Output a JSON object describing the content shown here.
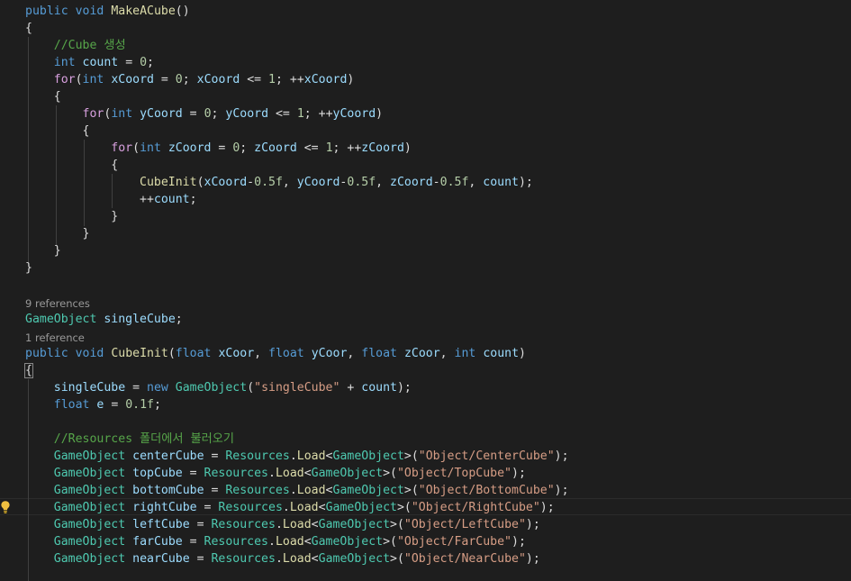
{
  "editor": {
    "lines": [
      [
        [
          "kw",
          "public"
        ],
        [
          "pl",
          " "
        ],
        [
          "kw",
          "void"
        ],
        [
          "pl",
          " "
        ],
        [
          "method",
          "MakeACube"
        ],
        [
          "pl",
          "()"
        ]
      ],
      [
        [
          "pl",
          "{"
        ]
      ],
      [
        [
          "pl",
          "    "
        ],
        [
          "cmt",
          "//Cube 생성"
        ]
      ],
      [
        [
          "pl",
          "    "
        ],
        [
          "kw",
          "int"
        ],
        [
          "pl",
          " "
        ],
        [
          "var",
          "count"
        ],
        [
          "pl",
          " = "
        ],
        [
          "num",
          "0"
        ],
        [
          "pl",
          ";"
        ]
      ],
      [
        [
          "pl",
          "    "
        ],
        [
          "ctrl",
          "for"
        ],
        [
          "pl",
          "("
        ],
        [
          "kw",
          "int"
        ],
        [
          "pl",
          " "
        ],
        [
          "var",
          "xCoord"
        ],
        [
          "pl",
          " = "
        ],
        [
          "num",
          "0"
        ],
        [
          "pl",
          "; "
        ],
        [
          "var",
          "xCoord"
        ],
        [
          "pl",
          " <= "
        ],
        [
          "num",
          "1"
        ],
        [
          "pl",
          "; ++"
        ],
        [
          "var",
          "xCoord"
        ],
        [
          "pl",
          ")"
        ]
      ],
      [
        [
          "pl",
          "    {"
        ]
      ],
      [
        [
          "pl",
          "        "
        ],
        [
          "ctrl",
          "for"
        ],
        [
          "pl",
          "("
        ],
        [
          "kw",
          "int"
        ],
        [
          "pl",
          " "
        ],
        [
          "var",
          "yCoord"
        ],
        [
          "pl",
          " = "
        ],
        [
          "num",
          "0"
        ],
        [
          "pl",
          "; "
        ],
        [
          "var",
          "yCoord"
        ],
        [
          "pl",
          " <= "
        ],
        [
          "num",
          "1"
        ],
        [
          "pl",
          "; ++"
        ],
        [
          "var",
          "yCoord"
        ],
        [
          "pl",
          ")"
        ]
      ],
      [
        [
          "pl",
          "        {"
        ]
      ],
      [
        [
          "pl",
          "            "
        ],
        [
          "ctrl",
          "for"
        ],
        [
          "pl",
          "("
        ],
        [
          "kw",
          "int"
        ],
        [
          "pl",
          " "
        ],
        [
          "var",
          "zCoord"
        ],
        [
          "pl",
          " = "
        ],
        [
          "num",
          "0"
        ],
        [
          "pl",
          "; "
        ],
        [
          "var",
          "zCoord"
        ],
        [
          "pl",
          " <= "
        ],
        [
          "num",
          "1"
        ],
        [
          "pl",
          "; ++"
        ],
        [
          "var",
          "zCoord"
        ],
        [
          "pl",
          ")"
        ]
      ],
      [
        [
          "pl",
          "            {"
        ]
      ],
      [
        [
          "pl",
          "                "
        ],
        [
          "method",
          "CubeInit"
        ],
        [
          "pl",
          "("
        ],
        [
          "var",
          "xCoord"
        ],
        [
          "pl",
          "-"
        ],
        [
          "num",
          "0.5f"
        ],
        [
          "pl",
          ", "
        ],
        [
          "var",
          "yCoord"
        ],
        [
          "pl",
          "-"
        ],
        [
          "num",
          "0.5f"
        ],
        [
          "pl",
          ", "
        ],
        [
          "var",
          "zCoord"
        ],
        [
          "pl",
          "-"
        ],
        [
          "num",
          "0.5f"
        ],
        [
          "pl",
          ", "
        ],
        [
          "var",
          "count"
        ],
        [
          "pl",
          ");"
        ]
      ],
      [
        [
          "pl",
          "                ++"
        ],
        [
          "var",
          "count"
        ],
        [
          "pl",
          ";"
        ]
      ],
      [
        [
          "pl",
          "            }"
        ]
      ],
      [
        [
          "pl",
          "        }"
        ]
      ],
      [
        [
          "pl",
          "    }"
        ]
      ],
      [
        [
          "pl",
          "}"
        ]
      ],
      [],
      {
        "lens": "9 references"
      },
      [
        [
          "type",
          "GameObject"
        ],
        [
          "pl",
          " "
        ],
        [
          "var",
          "singleCube"
        ],
        [
          "pl",
          ";"
        ]
      ],
      {
        "lens": "1 reference"
      },
      [
        [
          "kw",
          "public"
        ],
        [
          "pl",
          " "
        ],
        [
          "kw",
          "void"
        ],
        [
          "pl",
          " "
        ],
        [
          "method",
          "CubeInit"
        ],
        [
          "pl",
          "("
        ],
        [
          "kw",
          "float"
        ],
        [
          "pl",
          " "
        ],
        [
          "var",
          "xCoor"
        ],
        [
          "pl",
          ", "
        ],
        [
          "kw",
          "float"
        ],
        [
          "pl",
          " "
        ],
        [
          "var",
          "yCoor"
        ],
        [
          "pl",
          ", "
        ],
        [
          "kw",
          "float"
        ],
        [
          "pl",
          " "
        ],
        [
          "var",
          "zCoor"
        ],
        [
          "pl",
          ", "
        ],
        [
          "kw",
          "int"
        ],
        [
          "pl",
          " "
        ],
        [
          "var",
          "count"
        ],
        [
          "pl",
          ")"
        ]
      ],
      [
        [
          "pl",
          "{"
        ]
      ],
      [
        [
          "pl",
          "    "
        ],
        [
          "var",
          "singleCube"
        ],
        [
          "pl",
          " = "
        ],
        [
          "kw",
          "new"
        ],
        [
          "pl",
          " "
        ],
        [
          "type",
          "GameObject"
        ],
        [
          "pl",
          "("
        ],
        [
          "str",
          "\"singleCube\""
        ],
        [
          "pl",
          " + "
        ],
        [
          "var",
          "count"
        ],
        [
          "pl",
          ");"
        ]
      ],
      [
        [
          "pl",
          "    "
        ],
        [
          "kw",
          "float"
        ],
        [
          "pl",
          " "
        ],
        [
          "var",
          "e"
        ],
        [
          "pl",
          " = "
        ],
        [
          "num",
          "0.1f"
        ],
        [
          "pl",
          ";"
        ]
      ],
      [],
      [
        [
          "pl",
          "    "
        ],
        [
          "cmt",
          "//Resources 폴더에서 불러오기"
        ]
      ],
      [
        [
          "pl",
          "    "
        ],
        [
          "type",
          "GameObject"
        ],
        [
          "pl",
          " "
        ],
        [
          "var",
          "centerCube"
        ],
        [
          "pl",
          " = "
        ],
        [
          "type",
          "Resources"
        ],
        [
          "pl",
          "."
        ],
        [
          "method",
          "Load"
        ],
        [
          "pl",
          "<"
        ],
        [
          "type",
          "GameObject"
        ],
        [
          "pl",
          ">("
        ],
        [
          "str",
          "\"Object/CenterCube\""
        ],
        [
          "pl",
          ");"
        ]
      ],
      [
        [
          "pl",
          "    "
        ],
        [
          "type",
          "GameObject"
        ],
        [
          "pl",
          " "
        ],
        [
          "var",
          "topCube"
        ],
        [
          "pl",
          " = "
        ],
        [
          "type",
          "Resources"
        ],
        [
          "pl",
          "."
        ],
        [
          "method",
          "Load"
        ],
        [
          "pl",
          "<"
        ],
        [
          "type",
          "GameObject"
        ],
        [
          "pl",
          ">("
        ],
        [
          "str",
          "\"Object/TopCube\""
        ],
        [
          "pl",
          ");"
        ]
      ],
      [
        [
          "pl",
          "    "
        ],
        [
          "type",
          "GameObject"
        ],
        [
          "pl",
          " "
        ],
        [
          "var",
          "bottomCube"
        ],
        [
          "pl",
          " = "
        ],
        [
          "type",
          "Resources"
        ],
        [
          "pl",
          "."
        ],
        [
          "method",
          "Load"
        ],
        [
          "pl",
          "<"
        ],
        [
          "type",
          "GameObject"
        ],
        [
          "pl",
          ">("
        ],
        [
          "str",
          "\"Object/BottomCube\""
        ],
        [
          "pl",
          ");"
        ]
      ],
      [
        [
          "pl",
          "    "
        ],
        [
          "type",
          "GameObject"
        ],
        [
          "pl",
          " "
        ],
        [
          "var",
          "rightCube"
        ],
        [
          "pl",
          " = "
        ],
        [
          "type",
          "Resources"
        ],
        [
          "pl",
          "."
        ],
        [
          "method",
          "Load"
        ],
        [
          "pl",
          "<"
        ],
        [
          "type",
          "GameObject"
        ],
        [
          "pl",
          ">("
        ],
        [
          "str",
          "\"Object/RightCube\""
        ],
        [
          "pl",
          ");"
        ]
      ],
      [
        [
          "pl",
          "    "
        ],
        [
          "type",
          "GameObject"
        ],
        [
          "pl",
          " "
        ],
        [
          "var",
          "leftCube"
        ],
        [
          "pl",
          " = "
        ],
        [
          "type",
          "Resources"
        ],
        [
          "pl",
          "."
        ],
        [
          "method",
          "Load"
        ],
        [
          "pl",
          "<"
        ],
        [
          "type",
          "GameObject"
        ],
        [
          "pl",
          ">("
        ],
        [
          "str",
          "\"Object/LeftCube\""
        ],
        [
          "pl",
          ");"
        ]
      ],
      [
        [
          "pl",
          "    "
        ],
        [
          "type",
          "GameObject"
        ],
        [
          "pl",
          " "
        ],
        [
          "var",
          "farCube"
        ],
        [
          "pl",
          " = "
        ],
        [
          "type",
          "Resources"
        ],
        [
          "pl",
          "."
        ],
        [
          "method",
          "Load"
        ],
        [
          "pl",
          "<"
        ],
        [
          "type",
          "GameObject"
        ],
        [
          "pl",
          ">("
        ],
        [
          "str",
          "\"Object/FarCube\""
        ],
        [
          "pl",
          ");"
        ]
      ],
      [
        [
          "pl",
          "    "
        ],
        [
          "type",
          "GameObject"
        ],
        [
          "pl",
          " "
        ],
        [
          "var",
          "nearCube"
        ],
        [
          "pl",
          " = "
        ],
        [
          "type",
          "Resources"
        ],
        [
          "pl",
          "."
        ],
        [
          "method",
          "Load"
        ],
        [
          "pl",
          "<"
        ],
        [
          "type",
          "GameObject"
        ],
        [
          "pl",
          ">("
        ],
        [
          "str",
          "\"Object/NearCube\""
        ],
        [
          "pl",
          ");"
        ]
      ]
    ]
  },
  "icons": {
    "lightbulb": "lightbulb-icon"
  },
  "colors": {
    "background": "#1e1e1e",
    "keyword": "#569cd6",
    "control": "#d8a0df",
    "type": "#4ec9b0",
    "method": "#dcdcaa",
    "variable": "#9cdcfe",
    "number": "#b5cea8",
    "string": "#d69d85",
    "comment": "#57a64a",
    "plain": "#dcdcdc",
    "codelens": "#999999"
  }
}
